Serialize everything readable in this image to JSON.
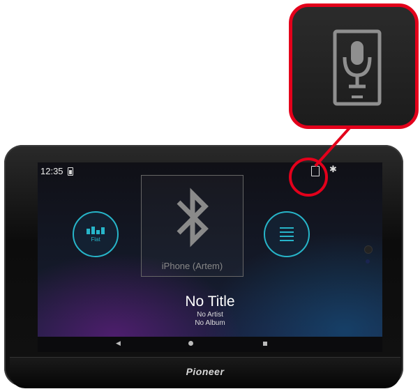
{
  "status_bar": {
    "time": "12:35"
  },
  "eq_button": {
    "label": "Flat"
  },
  "now_playing": {
    "source_device": "iPhone (Artem)",
    "title": "No Title",
    "artist": "No Artist",
    "album": "No Album"
  },
  "device": {
    "brand": "Pioneer"
  },
  "icons": {
    "status": [
      "battery-icon",
      "mic-phone-icon",
      "bluetooth-icon"
    ],
    "controls": [
      "equalizer-icon",
      "list-icon"
    ],
    "nav": [
      "back-icon",
      "home-icon",
      "recent-apps-icon"
    ],
    "callout": "mic-phone-icon"
  },
  "colors": {
    "accent": "#27b5c9",
    "callout": "#e3001b"
  }
}
